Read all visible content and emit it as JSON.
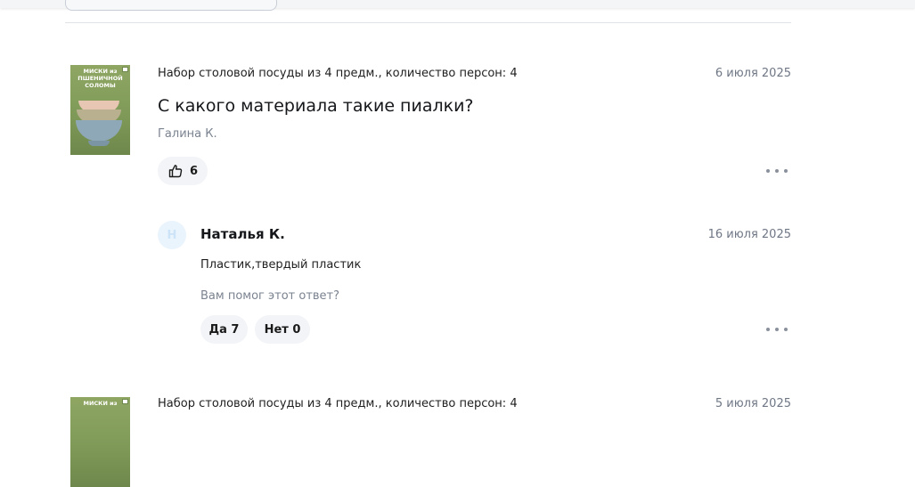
{
  "questions": [
    {
      "thumb_text": "МИСКИ из ПШЕНИЧНОЙ СОЛОМЫ",
      "product": "Набор столовой посуды из 4 предм., количество персон: 4",
      "date": "6 июля 2025",
      "question": "С какого материала такие пиалки?",
      "author": "Галина К.",
      "likes": "6",
      "answer": {
        "avatar_letter": "Н",
        "author": "Наталья К.",
        "date": "16 июля 2025",
        "text": "Пластик,твердый пластик",
        "helpful_prompt": "Вам помог этот ответ?",
        "yes_label": "Да 7",
        "no_label": "Нет 0"
      }
    },
    {
      "thumb_text": "МИСКИ из",
      "product": "Набор столовой посуды из 4 предм., количество персон: 4",
      "date": "5 июля 2025"
    }
  ],
  "icons": {
    "like": "thumbs-up-icon",
    "more": "more-dots-icon"
  },
  "colors": {
    "pill_bg": "#f2f4f7",
    "muted_text": "#7b8390",
    "avatar_bg": "#eaf4fd"
  }
}
